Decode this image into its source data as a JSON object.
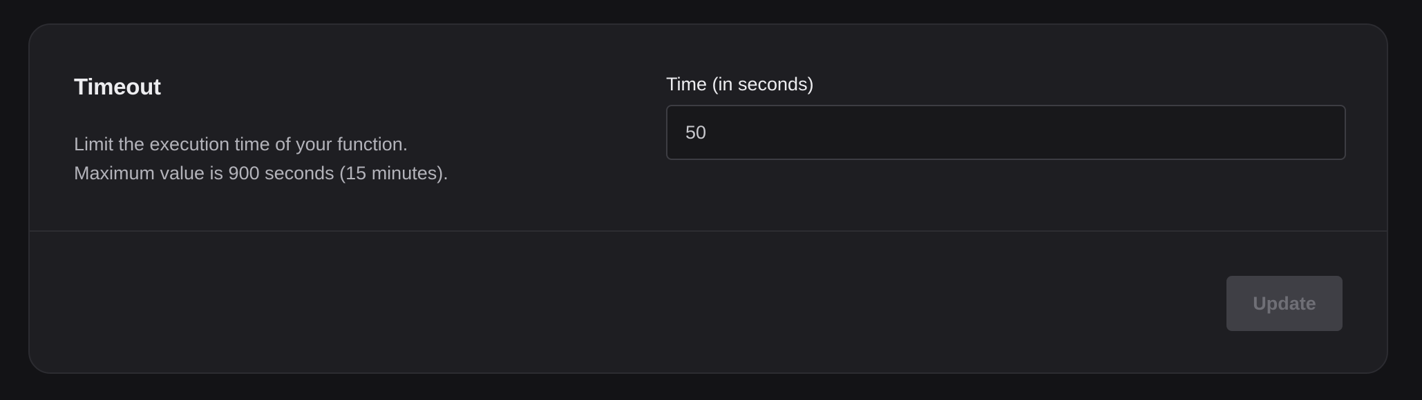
{
  "section": {
    "title": "Timeout",
    "description_line1": "Limit the execution time of your function.",
    "description_line2": "Maximum value is 900 seconds (15 minutes)."
  },
  "timeout_field": {
    "label": "Time (in seconds)",
    "value": "50"
  },
  "footer": {
    "update_label": "Update",
    "update_disabled": true
  },
  "colors": {
    "page_background": "#131316",
    "card_background": "#1e1e22",
    "input_background": "#18181b",
    "button_disabled_background": "#3f3f45"
  }
}
